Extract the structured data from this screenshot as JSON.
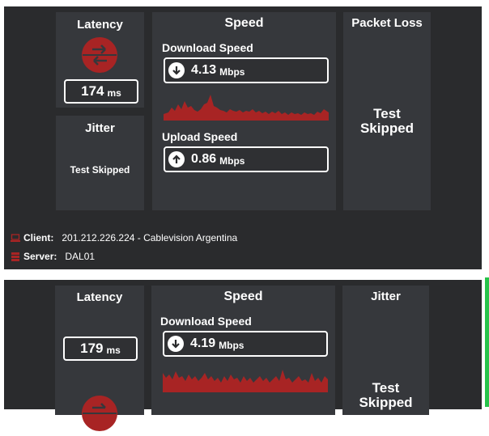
{
  "result1": {
    "latency": {
      "title": "Latency",
      "value": "174",
      "unit": "ms"
    },
    "jitter": {
      "title": "Jitter",
      "status": "Test Skipped"
    },
    "speed": {
      "title": "Speed",
      "download": {
        "label": "Download Speed",
        "value": "4.13",
        "unit": "Mbps"
      },
      "upload": {
        "label": "Upload Speed",
        "value": "0.86",
        "unit": "Mbps"
      }
    },
    "packet_loss": {
      "title": "Packet Loss",
      "status_line1": "Test",
      "status_line2": "Skipped"
    },
    "client": {
      "label": "Client:",
      "value": "201.212.226.224 - Cablevision Argentina"
    },
    "server": {
      "label": "Server:",
      "value": "DAL01"
    }
  },
  "result2": {
    "latency": {
      "title": "Latency",
      "value": "179",
      "unit": "ms"
    },
    "speed": {
      "title": "Speed",
      "download": {
        "label": "Download Speed",
        "value": "4.19",
        "unit": "Mbps"
      }
    },
    "jitter": {
      "title": "Jitter",
      "status_line1": "Test",
      "status_line2": "Skipped"
    }
  },
  "colors": {
    "panel_bg": "#2a2b2d",
    "box_bg": "#36383c",
    "accent_red": "#a82424",
    "status_green": "#27c34a"
  }
}
